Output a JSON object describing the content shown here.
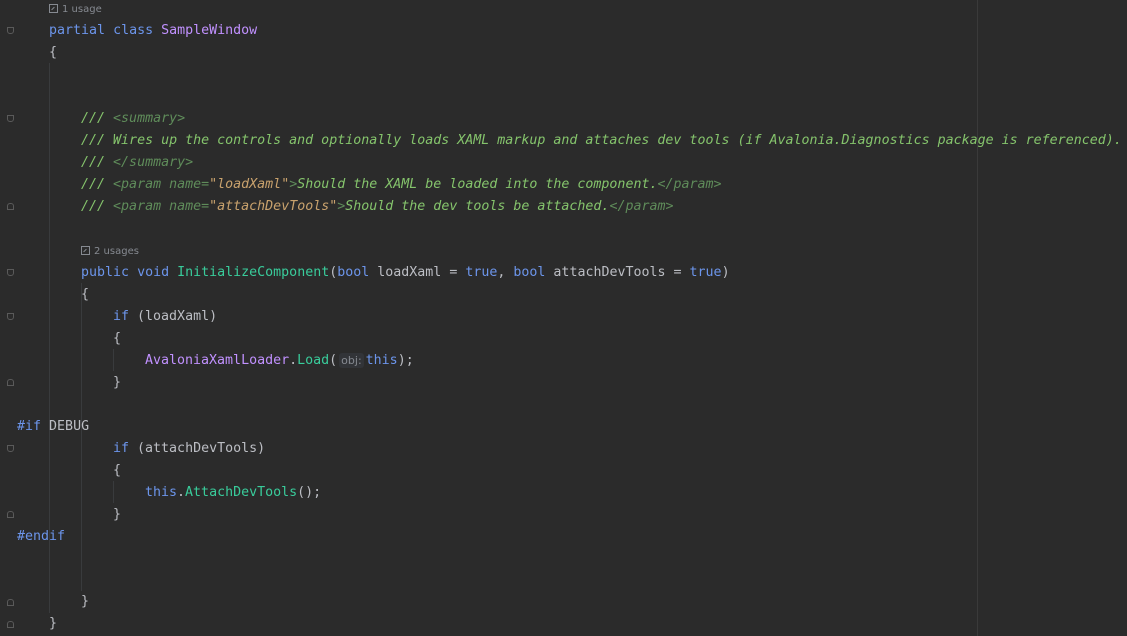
{
  "usages": {
    "class_usage": "1 usage",
    "method_usage": "2 usages"
  },
  "code": {
    "class_decl": {
      "kw1": "partial",
      "kw2": "class",
      "name": "SampleWindow"
    },
    "brace_open": "{",
    "brace_close": "}",
    "doc": {
      "prefix": "///",
      "summary_open": "<summary>",
      "summary_text": "Wires up the controls and optionally loads XAML markup and attaches dev tools (if Avalonia.Diagnostics package is referenced).",
      "summary_close": "</summary>",
      "param1_open_a": "<param",
      "param1_attr": "name=",
      "param1_value": "\"loadXaml\"",
      "param1_gt": ">",
      "param1_text": "Should the XAML be loaded into the component.",
      "param1_close": "</param>",
      "param2_value": "\"attachDevTools\"",
      "param2_text": "Should the dev tools be attached."
    },
    "method": {
      "public": "public",
      "void": "void",
      "name": "InitializeComponent",
      "open_paren": "(",
      "bool": "bool",
      "p1": " loadXaml = ",
      "true": "true",
      "comma": ", ",
      "p2": " attachDevTools = ",
      "close_paren": ")"
    },
    "if1": {
      "kw": "if",
      "cond": "(loadXaml)"
    },
    "load_call": {
      "cls": "AvaloniaXamlLoader",
      "dot": ".",
      "method": "Load",
      "open": "(",
      "hint": "obj:",
      "arg": "this",
      "close": ");"
    },
    "pre_if": {
      "directive": "#if",
      "symbol": "DEBUG"
    },
    "if2": {
      "kw": "if",
      "cond": "(attachDevTools)"
    },
    "attach_call": {
      "this": "this",
      "dot": ".",
      "method": "AttachDevTools",
      "rest": "();"
    },
    "pre_endif": "#endif"
  },
  "colors": {
    "background": "#2b2b2b",
    "keyword": "#6c95eb",
    "class": "#c191ff",
    "method": "#39cc9b",
    "comment": "#85c46c",
    "string": "#c9a26d"
  }
}
